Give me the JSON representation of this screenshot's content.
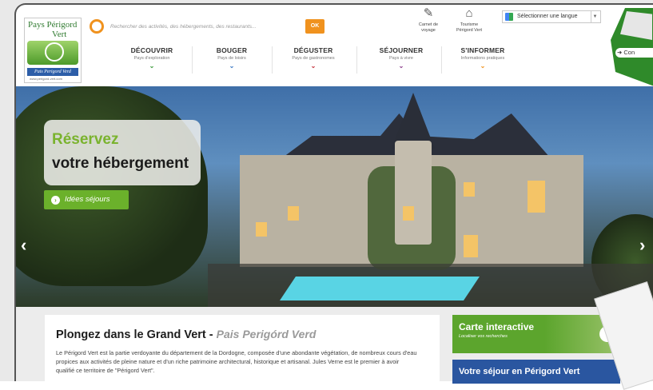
{
  "logo": {
    "line1": "Pays Périgord",
    "line2": "Vert",
    "banner": "Pais Perigord Verd",
    "url": "www.perigord-vert.com"
  },
  "search": {
    "placeholder": "Rechercher des activités, des hébergements, des restaurants...",
    "button": "OK"
  },
  "tools": [
    {
      "label": "Carnet de voyage",
      "icon": "notebook-icon"
    },
    {
      "label": "Tourisme Périgord Vert",
      "icon": "house-icon"
    }
  ],
  "language": {
    "label": "Sélectionner une langue"
  },
  "map_corner": {
    "label": "Con"
  },
  "nav": [
    {
      "title": "DÉCOUVRIR",
      "subtitle": "Pays d'exploration",
      "color": "#3a9a3a"
    },
    {
      "title": "BOUGER",
      "subtitle": "Pays de loisirs",
      "color": "#3a77c4"
    },
    {
      "title": "DÉGUSTER",
      "subtitle": "Pays de gastronomes",
      "color": "#c4303a"
    },
    {
      "title": "SÉJOURNER",
      "subtitle": "Pays à vivre",
      "color": "#8a3a8a"
    },
    {
      "title": "S'INFORMER",
      "subtitle": "Informations pratiques",
      "color": "#f0921e"
    }
  ],
  "hero": {
    "cta_line1": "Réservez",
    "cta_line2": "votre hébergement",
    "button": "Idées séjours"
  },
  "intro": {
    "title": "Plongez dans le Grand Vert -",
    "subtitle": "Pais Perigórd Verd",
    "text": "Le Périgord Vert est la partie verdoyante du département de la Dordogne, composée d'une abondante végétation, de nombreux cours d'eau propices aux activités de pleine nature et d'un riche patrimoine architectural, historique et artisanal. Jules Verne est le premier à avoir qualifié ce territoire de \"Périgord Vert\"."
  },
  "sidebar": {
    "map_title": "Carte interactive",
    "map_subtitle": "Localiser vos recherches",
    "stay_title": "Votre séjour en Périgord Vert"
  }
}
